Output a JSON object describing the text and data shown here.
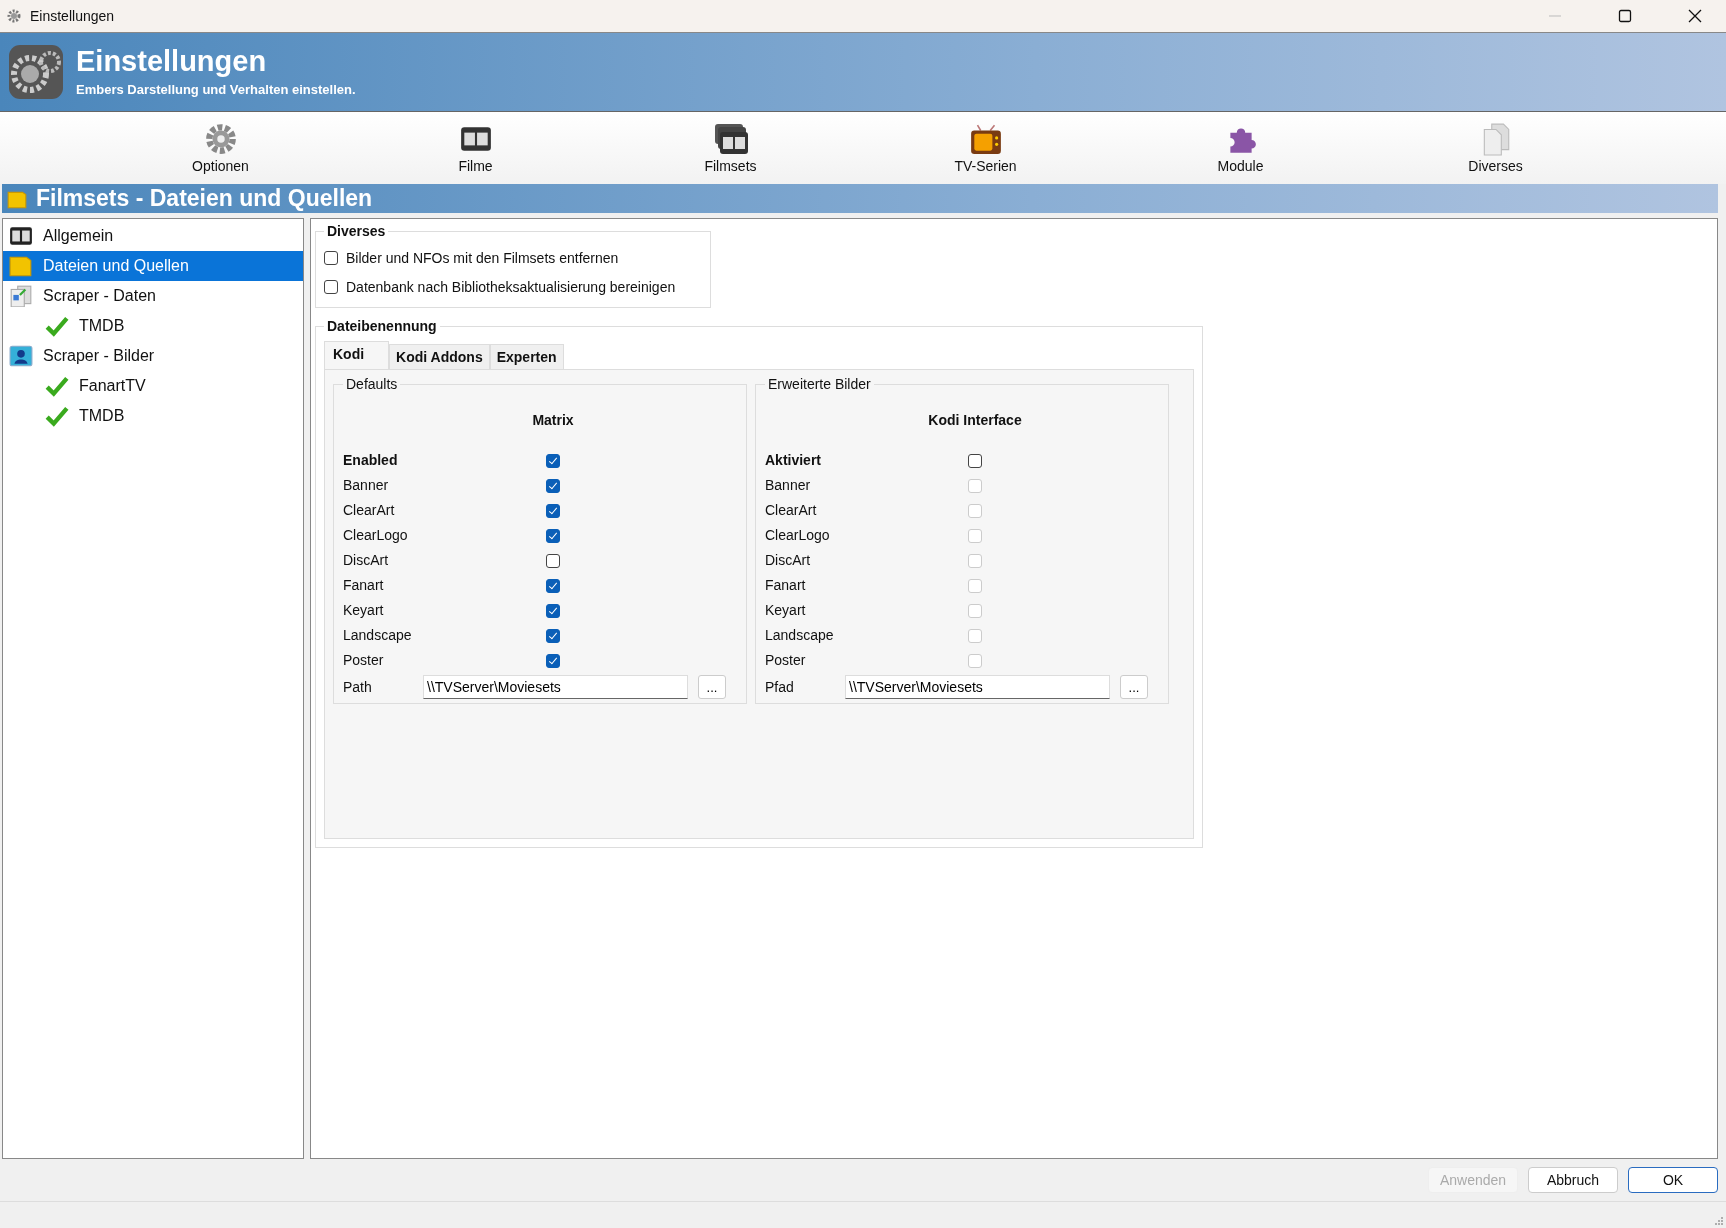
{
  "window": {
    "title": "Einstellungen"
  },
  "header": {
    "title": "Einstellungen",
    "subtitle": "Embers Darstellung und Verhalten einstellen."
  },
  "toolbar": [
    {
      "label": "Optionen",
      "kind": "gear"
    },
    {
      "label": "Filme",
      "kind": "film"
    },
    {
      "label": "Filmsets",
      "kind": "filmsets"
    },
    {
      "label": "TV-Serien",
      "kind": "tv"
    },
    {
      "label": "Module",
      "kind": "puzzle"
    },
    {
      "label": "Diverses",
      "kind": "docs"
    }
  ],
  "section_title": "Filmsets - Dateien und Quellen",
  "sidebar": {
    "items": [
      {
        "label": "Allgemein",
        "kind": "film",
        "selected": false
      },
      {
        "label": "Dateien und Quellen",
        "kind": "folder",
        "selected": true
      },
      {
        "label": "Scraper - Daten",
        "kind": "data",
        "selected": false,
        "children": [
          {
            "label": "TMDB",
            "kind": "check",
            "selected": false
          }
        ]
      },
      {
        "label": "Scraper - Bilder",
        "kind": "image",
        "selected": false,
        "children": [
          {
            "label": "FanartTV",
            "kind": "check",
            "selected": false
          },
          {
            "label": "TMDB",
            "kind": "check",
            "selected": false
          }
        ]
      }
    ]
  },
  "diverses": {
    "title": "Diverses",
    "options": [
      {
        "label": "Bilder und NFOs mit den Filmsets entfernen",
        "checked": false
      },
      {
        "label": "Datenbank nach Bibliotheksaktualisierung bereinigen",
        "checked": false
      }
    ]
  },
  "naming": {
    "title": "Dateibenennung",
    "tabs": [
      {
        "label": "Kodi",
        "selected": true
      },
      {
        "label": "Kodi Addons",
        "selected": false
      },
      {
        "label": "Experten",
        "selected": false
      }
    ],
    "groups": [
      {
        "title": "Defaults",
        "heading": "Matrix",
        "path_label": "Path",
        "path_value": "\\\\TVServer\\Moviesets",
        "browse_label": "...",
        "rows": [
          {
            "label": "Enabled",
            "kind": "master",
            "checked": true,
            "disabled": false
          },
          {
            "label": "Banner",
            "kind": "image",
            "checked": true,
            "disabled": false
          },
          {
            "label": "ClearArt",
            "kind": "image",
            "checked": true,
            "disabled": false
          },
          {
            "label": "ClearLogo",
            "kind": "image",
            "checked": true,
            "disabled": false
          },
          {
            "label": "DiscArt",
            "kind": "image",
            "checked": false,
            "disabled": false
          },
          {
            "label": "Fanart",
            "kind": "image",
            "checked": true,
            "disabled": false
          },
          {
            "label": "Keyart",
            "kind": "image",
            "checked": true,
            "disabled": false
          },
          {
            "label": "Landscape",
            "kind": "image",
            "checked": true,
            "disabled": false
          },
          {
            "label": "Poster",
            "kind": "image",
            "checked": true,
            "disabled": false
          }
        ]
      },
      {
        "title": "Erweiterte Bilder",
        "heading": "Kodi Interface",
        "path_label": "Pfad",
        "path_value": "\\\\TVServer\\Moviesets",
        "browse_label": "...",
        "rows": [
          {
            "label": "Aktiviert",
            "kind": "master",
            "checked": false,
            "disabled": false
          },
          {
            "label": "Banner",
            "kind": "image",
            "checked": false,
            "disabled": true
          },
          {
            "label": "ClearArt",
            "kind": "image",
            "checked": false,
            "disabled": true
          },
          {
            "label": "ClearLogo",
            "kind": "image",
            "checked": false,
            "disabled": true
          },
          {
            "label": "DiscArt",
            "kind": "image",
            "checked": false,
            "disabled": true
          },
          {
            "label": "Fanart",
            "kind": "image",
            "checked": false,
            "disabled": true
          },
          {
            "label": "Keyart",
            "kind": "image",
            "checked": false,
            "disabled": true
          },
          {
            "label": "Landscape",
            "kind": "image",
            "checked": false,
            "disabled": true
          },
          {
            "label": "Poster",
            "kind": "image",
            "checked": false,
            "disabled": true
          }
        ]
      }
    ]
  },
  "buttons": [
    {
      "label": "Anwenden",
      "disabled": true,
      "default": false
    },
    {
      "label": "Abbruch",
      "disabled": false,
      "default": false
    },
    {
      "label": "OK",
      "disabled": false,
      "default": true
    }
  ]
}
